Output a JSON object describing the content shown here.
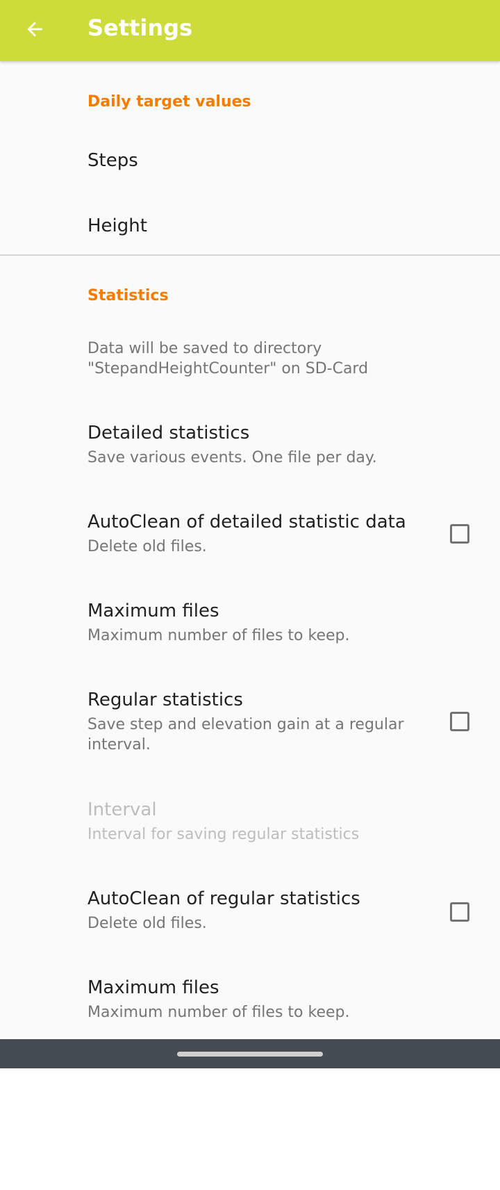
{
  "app_bar": {
    "title": "Settings",
    "back_icon": "arrow-back-icon",
    "color": "#cddc39"
  },
  "sections": {
    "daily": {
      "header": "Daily target values",
      "steps": {
        "title": "Steps"
      },
      "height": {
        "title": "Height"
      }
    },
    "statistics": {
      "header": "Statistics",
      "info": "Data will be saved to directory \"StepandHeightCounter\" on SD-Card",
      "detailed": {
        "title": "Detailed statistics",
        "summary": "Save various events. One file per day."
      },
      "autoclean_detailed": {
        "title": "AutoClean of detailed statistic data",
        "summary": "Delete old files.",
        "checked": false
      },
      "max_files_detailed": {
        "title": "Maximum files",
        "summary": "Maximum number of files to keep."
      },
      "regular": {
        "title": "Regular statistics",
        "summary": "Save step and elevation gain at a regular interval.",
        "checked": false
      },
      "interval": {
        "title": "Interval",
        "summary": "Interval for saving regular statistics",
        "enabled": false
      },
      "autoclean_regular": {
        "title": "AutoClean of regular statistics",
        "summary": "Delete old files.",
        "checked": false
      },
      "max_files_regular": {
        "title": "Maximum files",
        "summary": "Maximum number of files to keep."
      }
    }
  },
  "colors": {
    "accent": "#f57c00",
    "background": "#fafafa",
    "nav_bar": "#454c52"
  }
}
